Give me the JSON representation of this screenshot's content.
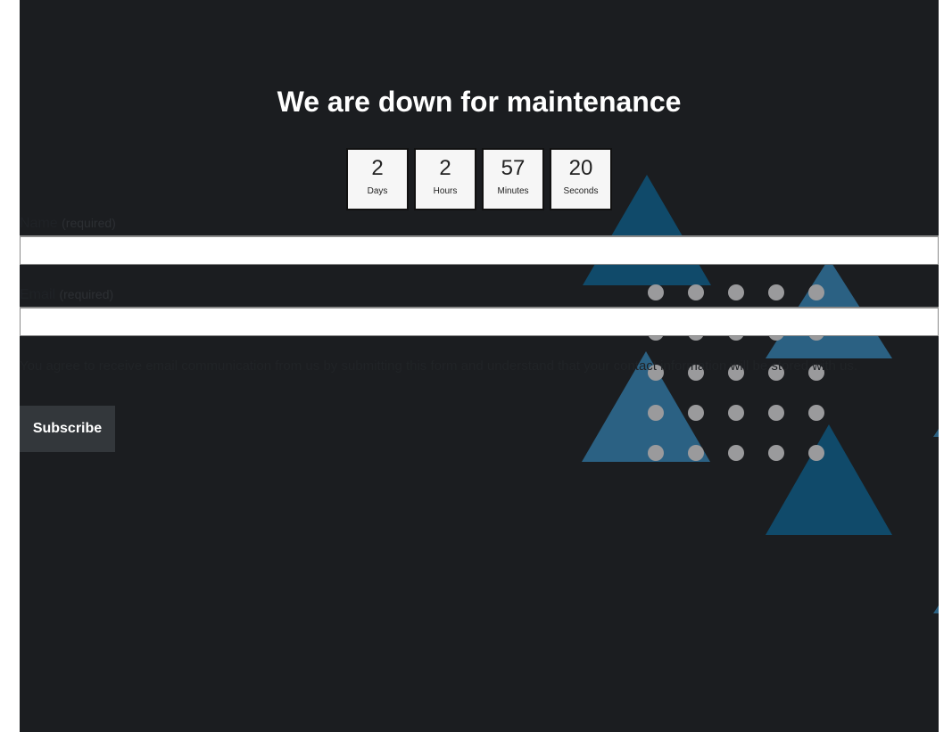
{
  "page": {
    "title": "We are down for maintenance"
  },
  "countdown": [
    {
      "value": "2",
      "label": "Days"
    },
    {
      "value": "2",
      "label": "Hours"
    },
    {
      "value": "57",
      "label": "Minutes"
    },
    {
      "value": "20",
      "label": "Seconds"
    }
  ],
  "form": {
    "name_label": "Name",
    "name_required": "(required)",
    "name_value": "",
    "email_label": "Email",
    "email_required": "(required)",
    "email_value": "",
    "consent_text": "You agree to receive email communication from us by submitting this form and understand that your contact information will be stored with us.",
    "subscribe_label": "Subscribe"
  },
  "colors": {
    "background": "#1b1d20",
    "triangle_dark": "#104a6a",
    "triangle_light": "#2b6183",
    "dot": "#9a9a9c",
    "button": "#33373b"
  }
}
